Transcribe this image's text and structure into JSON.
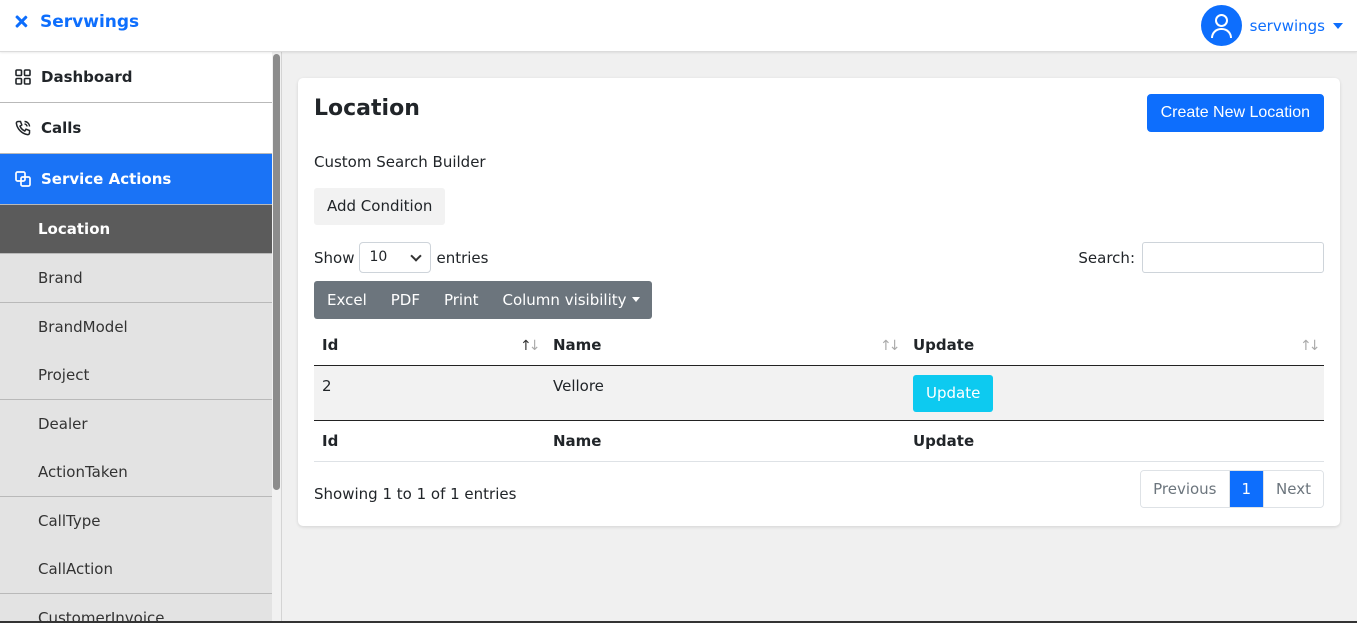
{
  "brand": {
    "name": "Servwings"
  },
  "user": {
    "name": "servwings"
  },
  "sidebar": {
    "items": [
      {
        "label": "Dashboard",
        "icon": "dashboard-grid-icon"
      },
      {
        "label": "Calls",
        "icon": "phone-call-icon"
      },
      {
        "label": "Service Actions",
        "icon": "service-actions-icon"
      }
    ],
    "sub_items": [
      {
        "label": "Location",
        "active": true
      },
      {
        "label": "Brand"
      },
      {
        "label": "BrandModel"
      },
      {
        "label": "Project"
      },
      {
        "label": "Dealer"
      },
      {
        "label": "ActionTaken"
      },
      {
        "label": "CallType"
      },
      {
        "label": "CallAction"
      },
      {
        "label": "CustomerInvoice"
      }
    ]
  },
  "main": {
    "title": "Location",
    "create_button": "Create New Location",
    "custom_search_label": "Custom Search Builder",
    "add_condition": "Add Condition",
    "show_label": "Show",
    "page_length": "10",
    "entries_label": "entries",
    "search_label": "Search:",
    "search_value": "",
    "buttons": [
      "Excel",
      "PDF",
      "Print",
      "Column visibility"
    ],
    "table": {
      "columns": [
        "Id",
        "Name",
        "Update"
      ],
      "rows": [
        {
          "id": "2",
          "name": "Vellore",
          "action": "Update"
        }
      ]
    },
    "info": "Showing 1 to 1 of 1 entries",
    "pagination": {
      "previous": "Previous",
      "current": "1",
      "next": "Next"
    }
  },
  "colors": {
    "primary": "#0d6efd",
    "info": "#0dcaf0",
    "secondary": "#6c757d",
    "sidebar_active": "#1a73f6",
    "sub_active": "#5b5b5b"
  }
}
